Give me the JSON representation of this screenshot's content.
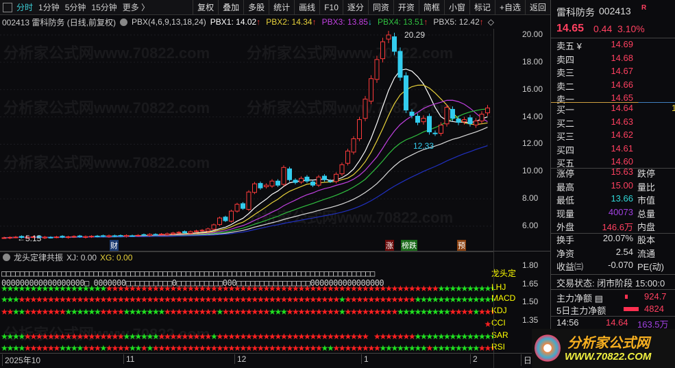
{
  "toolbar": {
    "periods": [
      "分时",
      "1分钟",
      "5分钟",
      "15分钟",
      "更多 〉"
    ],
    "buttons": [
      "复权",
      "叠加",
      "多股",
      "统计",
      "画线",
      "F10",
      "逐分",
      "同资",
      "开资",
      "简框",
      "小窗",
      "标记",
      "+自选",
      "返回"
    ]
  },
  "info": {
    "code_name": "002413 雷科防务 (日线,前复权)",
    "indicator": "PBX(4,6,9,13,18,24)",
    "pbx": [
      {
        "label": "PBX1: 14.02",
        "arrow": "↑",
        "color": "#ffffff"
      },
      {
        "label": "PBX2: 14.34",
        "arrow": "↑",
        "color": "#e8d23a"
      },
      {
        "label": "PBX3: 13.85",
        "arrow": "↓",
        "color": "#c040e0"
      },
      {
        "label": "PBX4: 13.51",
        "arrow": "↑",
        "color": "#30c040"
      },
      {
        "label": "PBX5: 12.42",
        "arrow": "↑",
        "color": "#cccccc"
      }
    ]
  },
  "chart_data": {
    "type": "candlestick",
    "ylim": [
      5,
      21
    ],
    "y_ticks": [
      "20.00",
      "18.00",
      "16.00",
      "14.00",
      "12.00",
      "10.00",
      "8.00",
      "6.00"
    ],
    "closes": [
      5.15,
      5.18,
      5.2,
      5.17,
      5.2,
      5.22,
      5.19,
      5.2,
      5.18,
      5.21,
      5.2,
      5.22,
      5.25,
      5.23,
      5.24,
      5.26,
      5.25,
      5.27,
      5.3,
      5.28,
      5.3,
      5.32,
      5.3,
      5.33,
      5.35,
      5.4,
      5.38,
      5.42,
      5.45,
      5.5,
      5.55,
      5.52,
      5.6,
      5.65,
      5.7,
      5.8,
      6.1,
      6.6,
      6.4,
      7.1,
      7.6,
      7.3,
      8.5,
      9.1,
      8.8,
      9.0,
      9.3,
      9.0,
      10.3,
      9.4,
      9.2,
      9.5,
      9.3,
      9.0,
      9.6,
      9.4,
      9.3,
      9.8,
      10.5,
      11.5,
      12.4,
      13.8,
      15.3,
      16.8,
      18.2,
      19.5,
      20.0,
      18.8,
      16.9,
      14.5,
      14.1,
      13.6,
      13.9,
      12.9,
      12.8,
      13.4,
      14.7,
      13.9,
      13.6,
      13.8,
      13.5,
      13.7,
      14.2,
      14.65
    ],
    "ma_periods": [
      4,
      6,
      9,
      13,
      18,
      24
    ],
    "ma_colors": [
      "#ffffff",
      "#e8d23a",
      "#c040e0",
      "#30c040",
      "#dddddd",
      "#2030c0"
    ],
    "annotations": {
      "high": "20.29",
      "low": "12.33",
      "start": "←5.15"
    },
    "x_labels": [
      "2025年10",
      "11",
      "12",
      "1",
      "2",
      "日"
    ]
  },
  "markers": {
    "cai": "财",
    "zhang": "涨",
    "bangdie": "榜跌",
    "yu": "预"
  },
  "indicator": {
    "name": "龙头定律共振",
    "xj": "XJ: 0.00",
    "xg": "XG: 0.00",
    "zeros": "□□□□□□□□□□□□□□□□□□□□□□□□□□□□□□□□□□□□□□□□□□□□□□□□□□□□□□□□□□□□□□□□□□□□□□□□□□□□□□□□□",
    "zeros2": "000000000000000000□ 0000000□□□□□□□□□□0□□□□□□□□□□000□□□□□□□□□□□□□□□□0000000000000000",
    "zero_label": "龙头定",
    "y_ticks": [
      "1.80",
      "1.65",
      "1.50",
      "1.35"
    ],
    "rows": [
      {
        "label": "LHJ",
        "pattern": "ggggggggggggggggggrrrrrrrrrrrrrrrrrrrrrrrrrrrrrrrrrrrrrrrrrrrrrrrrrrrrrrrrrggggggggggggg"
      },
      {
        "label": "MACD",
        "pattern": "gggrrrrrrrrrrrrrrrrrrrrrrrrrrrrrrrrrrrrrrrrrrrrrrrrrrrrrrrgrrrrrrrrrrrrgggggggggggggggg"
      },
      {
        "label": "KDJ",
        "pattern": "rrggrrrrrrrggggggrrrrgggggggrrrrrrrrrgrrrrrrrrgggrrrrrrrrrgrrrrrrrrrgggggggggrrrrgrrrrr"
      },
      {
        "label": "CCI",
        "pattern": "                                                                                   r"
      },
      {
        "label": "SAR",
        "pattern": "ggggrrrrrrrrrrrrrrrrrggggggrrrrrrrrrgrrrrrrrrrrrrrrrrrrrrrrrrrr rrrrrrrggggggggggggggggr"
      },
      {
        "label": "RSI",
        "pattern": "ggggrrrrrrggggrrrgrrrrggrgrrrrrrrrrrrrrrrrrrrrrrrrrrrrrggrrrrrrrrggggggggrggggggggrrr"
      }
    ]
  },
  "side": {
    "name": "雷科防务",
    "code": "002413",
    "r_badge": "R",
    "price": "14.65",
    "change": "0.44",
    "pct": "3.10%",
    "asks": [
      {
        "k": "卖五 ¥",
        "v": "14.69"
      },
      {
        "k": "卖四",
        "v": "14.68"
      },
      {
        "k": "卖三",
        "v": "14.67"
      },
      {
        "k": "卖二",
        "v": "14.66"
      },
      {
        "k": "卖一",
        "v": "14.65"
      }
    ],
    "bids": [
      {
        "k": "买一",
        "v": "14.64",
        "q": "1"
      },
      {
        "k": "买二",
        "v": "14.63"
      },
      {
        "k": "买三",
        "v": "14.62"
      },
      {
        "k": "买四",
        "v": "14.61"
      },
      {
        "k": "买五",
        "v": "14.60"
      }
    ],
    "stats": [
      {
        "k": "涨停",
        "v": "15.63",
        "k2": "跌停",
        "c": "#ff4060"
      },
      {
        "k": "最高",
        "v": "15.00",
        "k2": "量比",
        "c": "#ff4060"
      },
      {
        "k": "最低",
        "v": "13.66",
        "k2": "市值",
        "c": "#30d8d8"
      },
      {
        "k": "现量",
        "v": "40073",
        "k2": "总量",
        "c": "#a040e0"
      },
      {
        "k": "外盘",
        "v": "146.6万",
        "k2": "内盘",
        "c": "#ff4060"
      }
    ],
    "stats2": [
      {
        "k": "换手",
        "v": "20.07%",
        "k2": "股本"
      },
      {
        "k": "净资",
        "v": "2.54",
        "k2": "流通"
      },
      {
        "k": "收益㈢",
        "v": "-0.070",
        "k2": "PE(动)"
      }
    ],
    "status": "交易状态: 闭市阶段 15:00:0",
    "flow": [
      {
        "k": "主力净额 ▤",
        "v": "924.7"
      },
      {
        "k": "5日主力净额",
        "v": "4824"
      }
    ],
    "tick": {
      "time": "14:56",
      "price": "14.64",
      "vol": "163.5万"
    },
    "logo": {
      "text": "分析家公式网",
      "url": "WWW.70822.COM"
    }
  },
  "watermark": "分析家公式网www.70822.com"
}
